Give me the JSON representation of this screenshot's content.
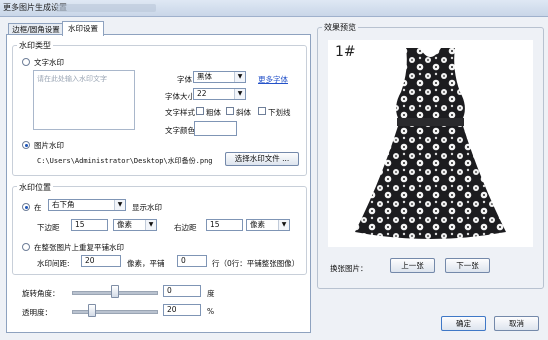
{
  "window": {
    "title": "更多图片生成设置"
  },
  "tabs": [
    {
      "label": "边框/圆角设置",
      "active": false
    },
    {
      "label": "水印设置",
      "active": true
    }
  ],
  "watermark_type": {
    "title": "水印类型",
    "text_option": "文字水印",
    "text_placeholder": "请在此处输入水印文字",
    "font_label": "字体：",
    "font_value": "黑体",
    "more_fonts": "更多字体",
    "size_label": "字体大小：",
    "size_value": "22",
    "style_label": "文字样式：",
    "bold": "粗体",
    "italic": "斜体",
    "underline": "下划线",
    "color_label": "文字颜色：",
    "image_option": "图片水印",
    "image_path": "C:\\Users\\Administrator\\Desktop\\水印备份.png",
    "choose_button": "选择水印文件 ..."
  },
  "position": {
    "title": "水印位置",
    "at_label": "在",
    "at_value": "右下角",
    "show_label": "显示水印",
    "bottom_label": "下边距",
    "bottom_value": "15",
    "bottom_unit": "像素",
    "right_label": "右边距",
    "right_value": "15",
    "right_unit": "像素",
    "tile_option": "在整张图片上重复平铺水印",
    "spacing_label": "水印间距:",
    "spacing_value": "20",
    "spacing_mid": "像素，平铺",
    "rows_value": "0",
    "rows_suffix": "行（0行：平铺整张图像）"
  },
  "rotation": {
    "label": "旋转角度：",
    "value": "0",
    "unit": "度",
    "level": 0.5
  },
  "opacity": {
    "label": "透明度：",
    "value": "20",
    "unit": "%",
    "level": 0.2
  },
  "preview": {
    "title": "效果预览",
    "image_label": "1#",
    "switch_label": "换张图片：",
    "prev": "上一张",
    "next": "下一张"
  },
  "footer": {
    "ok": "确定",
    "cancel": "取消"
  }
}
